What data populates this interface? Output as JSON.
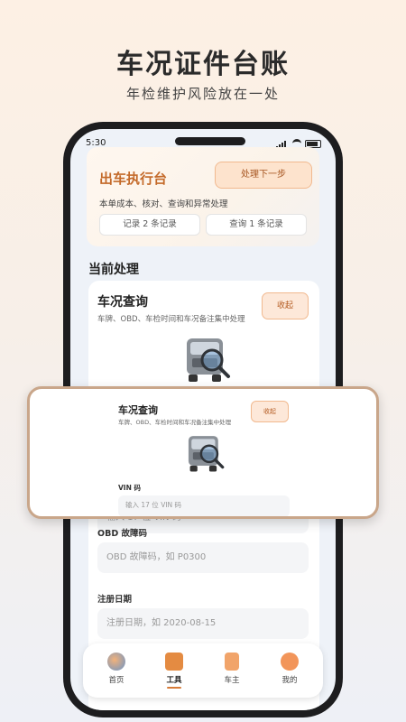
{
  "hero": {
    "title": "车况证件台账",
    "subtitle": "年检维护风险放在一处"
  },
  "status_bar": {
    "time": "5:30"
  },
  "dispatch": {
    "title": "出车执行台",
    "action_label": "处理下一步",
    "description": "本单成本、核对、查询和异常处理",
    "records_label": "记录 2 条记录",
    "query_label": "查询 1 条记录"
  },
  "current": {
    "section_title": "当前处理",
    "card_title": "车况查询",
    "card_desc": "车牌、OBD、车检时间和车况备注集中处理",
    "collapse_label": "收起",
    "image_icon": "truck-search-icon"
  },
  "fields": {
    "vin": {
      "label": "VIN 码",
      "placeholder": "输入 17 位 VIN 码"
    },
    "obd": {
      "label": "OBD 故障码",
      "placeholder": "OBD 故障码，如 P0300"
    },
    "reg_date": {
      "label": "注册日期",
      "placeholder": "注册日期，如 2020-08-15"
    }
  },
  "tabs": [
    {
      "label": "首页",
      "icon": "home-icon"
    },
    {
      "label": "工具",
      "icon": "toolbox-icon",
      "active": true
    },
    {
      "label": "车主",
      "icon": "fuel-pump-icon"
    },
    {
      "label": "我的",
      "icon": "user-icon"
    }
  ],
  "colors": {
    "accent": "#d77b38",
    "accent_soft": "#fde3cd",
    "title_brown": "#c46a2a"
  }
}
